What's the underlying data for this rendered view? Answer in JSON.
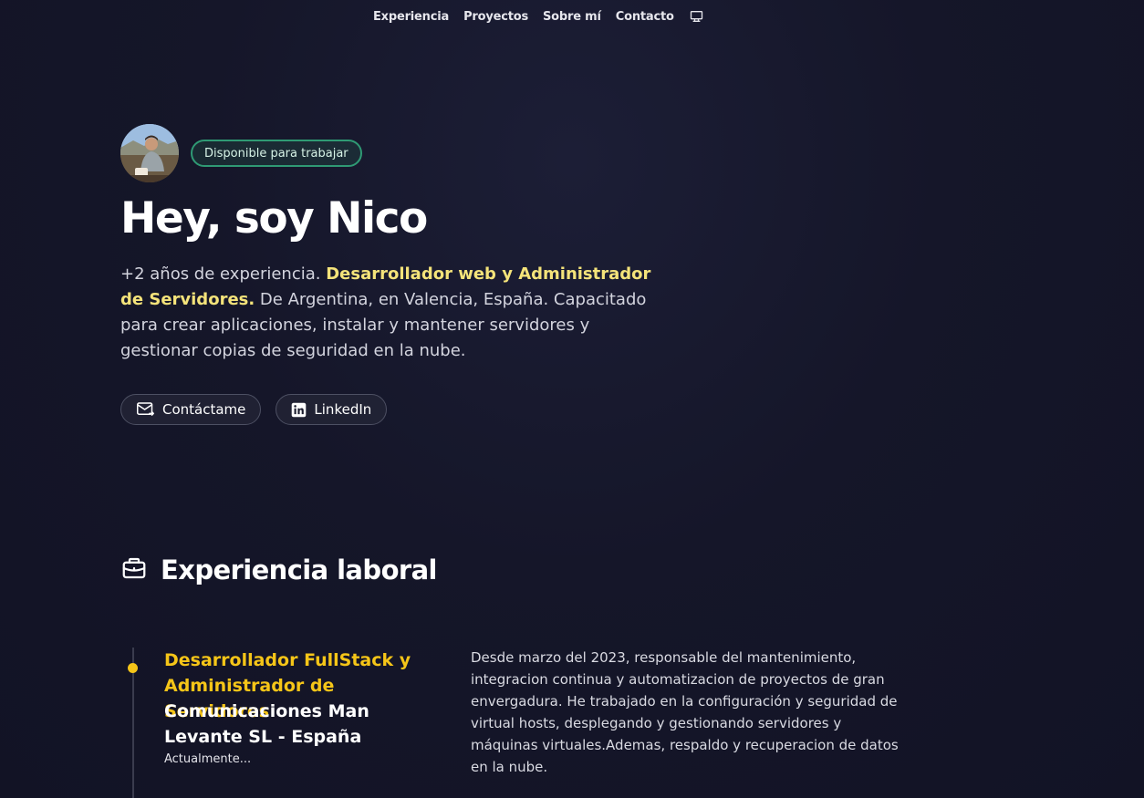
{
  "nav": {
    "links": [
      "Experiencia",
      "Proyectos",
      "Sobre mí",
      "Contacto"
    ],
    "theme_icon": "monitor-icon"
  },
  "hero": {
    "avatar_icon": "profile-photo",
    "badge": "Disponible para trabajar",
    "title": "Hey, soy Nico",
    "intro_pre": "+2 años de experiencia. ",
    "intro_highlight": "Desarrollador web y Administrador de Servidores.",
    "intro_post": " De Argentina, en Valencia, España. Capacitado para crear aplicaciones, instalar y mantener servidores y gestionar copias de seguridad en la nube.",
    "buttons": [
      {
        "label": "Contáctame",
        "icon": "mail-icon"
      },
      {
        "label": "LinkedIn",
        "icon": "linkedin-icon"
      }
    ]
  },
  "experience": {
    "title": "Experiencia laboral",
    "icon": "briefcase-icon",
    "jobs": [
      {
        "role": "Desarrollador FullStack y Administrador de Servidores",
        "company": "Comunicaciones Man Levante SL - España",
        "date": "Actualmente...",
        "description": "Desde marzo del 2023, responsable del mantenimiento, integracion continua y automatizacion de proyectos de gran envergadura. He trabajado en la configuración y seguridad de virtual hosts, desplegando y gestionando servidores y máquinas virtuales.Ademas, respaldo y recuperacion de datos en la nube."
      }
    ]
  },
  "colors": {
    "accent_yellow": "#f5c518",
    "highlight_yellow": "#f4e37a",
    "badge_green": "#2f9a74",
    "background": "#151629"
  }
}
